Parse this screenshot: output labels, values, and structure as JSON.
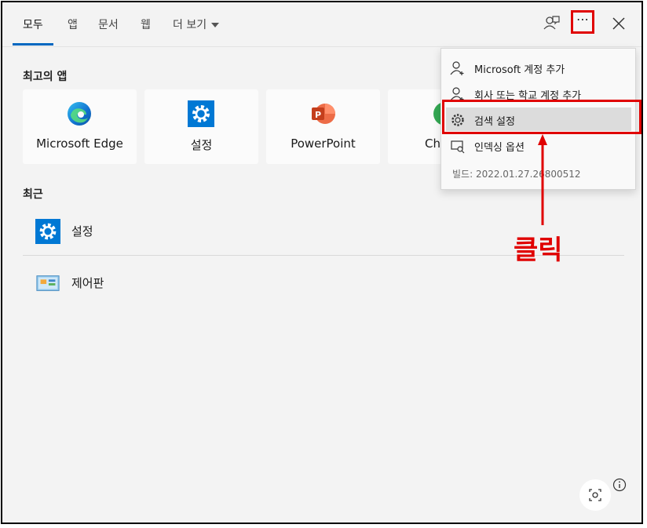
{
  "tabs": [
    {
      "label": "모두",
      "active": true
    },
    {
      "label": "앱"
    },
    {
      "label": "문서"
    },
    {
      "label": "웹"
    },
    {
      "label": "더 보기"
    }
  ],
  "top_icons": {
    "feedback": "feedback-icon",
    "more": "⋯",
    "close": "close-icon"
  },
  "sections": {
    "top_apps": "최고의 앱",
    "recent": "최근"
  },
  "top_apps": [
    {
      "label": "Microsoft Edge",
      "icon": "edge-icon"
    },
    {
      "label": "설정",
      "icon": "settings-gear-icon"
    },
    {
      "label": "PowerPoint",
      "icon": "powerpoint-icon"
    },
    {
      "label": "Chr",
      "icon": "chrome-icon"
    }
  ],
  "recent": [
    {
      "label": "설정",
      "icon": "settings-gear-icon"
    },
    {
      "label": "제어판",
      "icon": "control-panel-icon"
    }
  ],
  "menu": {
    "items": [
      {
        "label": "Microsoft 계정 추가",
        "icon": "person-add-icon"
      },
      {
        "label": "회사 또는 학교 계정 추가",
        "icon": "person-add-icon"
      },
      {
        "label": "검색 설정",
        "icon": "gear-icon",
        "highlighted": true
      },
      {
        "label": "인덱싱 옵션",
        "icon": "indexing-icon"
      }
    ],
    "build": "빌드: 2022.01.27.26800512"
  },
  "annotation": {
    "text": "클릭",
    "color": "#e00000"
  },
  "colors": {
    "accent": "#0067c0",
    "highlight": "#e00000"
  }
}
